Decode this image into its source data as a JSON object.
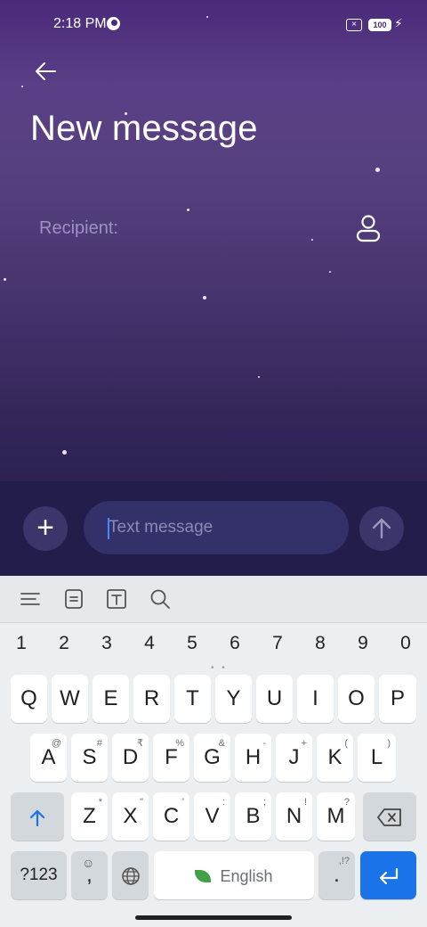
{
  "status": {
    "time": "2:18 PM",
    "battery": "100"
  },
  "header": {
    "title": "New message"
  },
  "recipient": {
    "label": "Recipient:"
  },
  "composer": {
    "placeholder": "Text message"
  },
  "keyboard": {
    "numbers": [
      "1",
      "2",
      "3",
      "4",
      "5",
      "6",
      "7",
      "8",
      "9",
      "0"
    ],
    "row1": [
      "Q",
      "W",
      "E",
      "R",
      "T",
      "Y",
      "U",
      "I",
      "O",
      "P"
    ],
    "row2": [
      "A",
      "S",
      "D",
      "F",
      "G",
      "H",
      "J",
      "K",
      "L"
    ],
    "row2_alts": [
      "@",
      "#",
      "₹",
      "%",
      "&",
      "-",
      "+",
      "(",
      ")"
    ],
    "row3": [
      "Z",
      "X",
      "C",
      "V",
      "B",
      "N",
      "M"
    ],
    "row3_alts": [
      "*",
      "\"",
      "'",
      ":",
      ";",
      "!",
      "?"
    ],
    "symbols_key": "?123",
    "comma_key": ",",
    "space_label": "English",
    "period_key": ".",
    "period_alt": ",!?"
  },
  "colors": {
    "accent": "#1a73e8",
    "caret": "#3d8bff"
  }
}
